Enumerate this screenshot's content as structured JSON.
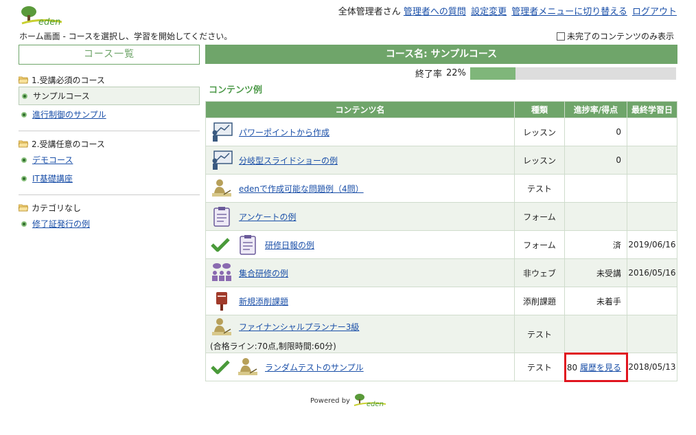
{
  "header": {
    "brand": "eden",
    "user": "全体管理者さん",
    "links": [
      "管理者への質問",
      "設定変更",
      "管理者メニューに切り替える",
      "ログアウト"
    ]
  },
  "intro": "ホーム画面 - コースを選択し、学習を開始してください。",
  "filter_label": "未完了のコンテンツのみ表示",
  "sidebar": {
    "title": "コース一覧",
    "groups": [
      {
        "label": "1.受講必須のコース",
        "items": [
          "サンプルコース",
          "進行制御のサンプル"
        ]
      },
      {
        "label": "2.受講任意のコース",
        "items": [
          "デモコース",
          "IT基礎講座"
        ]
      },
      {
        "label": "カテゴリなし",
        "items": [
          "修了証発行の例"
        ]
      }
    ]
  },
  "main": {
    "course_title": "コース名: サンプルコース",
    "completion_label": "終了率",
    "completion_value": "22%",
    "completion_fraction": 0.22,
    "section_title": "コンテンツ例",
    "columns": [
      "コンテンツ名",
      "種類",
      "進捗率/得点",
      "最終学習日"
    ],
    "rows": [
      {
        "name": "パワーポイントから作成",
        "type": "レッスン",
        "score": "0",
        "date": "",
        "icon": "presentation-icon",
        "done": false
      },
      {
        "name": "分岐型スライドショーの例",
        "type": "レッスン",
        "score": "0",
        "date": "",
        "icon": "presentation-icon",
        "done": false
      },
      {
        "name": "edenで作成可能な問題例（4問）",
        "type": "テスト",
        "score": "",
        "date": "",
        "icon": "test-icon",
        "done": false
      },
      {
        "name": "アンケートの例",
        "type": "フォーム",
        "score": "",
        "date": "",
        "icon": "clipboard-icon",
        "done": false
      },
      {
        "name": "研修日報の例",
        "type": "フォーム",
        "score": "済",
        "date": "2019/06/16",
        "icon": "clipboard-icon",
        "done": true
      },
      {
        "name": "集合研修の例",
        "type": "非ウェブ",
        "score": "未受講",
        "date": "2016/05/16",
        "icon": "group-icon",
        "done": false
      },
      {
        "name": "新規添削課題",
        "type": "添削課題",
        "score": "未着手",
        "date": "",
        "icon": "postbox-icon",
        "done": false
      },
      {
        "name": "ファイナンシャルプランナー3級",
        "note": "(合格ライン:70点,制限時間:60分)",
        "type": "テスト",
        "score": "",
        "date": "",
        "icon": "test-icon",
        "done": false
      },
      {
        "name": "ランダムテストのサンプル",
        "type": "テスト",
        "score": "80",
        "history": "履歴を見る",
        "date": "2018/05/13",
        "icon": "test-icon",
        "done": true
      }
    ]
  },
  "footer": {
    "powered_by": "Powered by",
    "brand": "eden"
  },
  "colors": {
    "accent": "#6fa56a",
    "row_alt": "#eef3ec",
    "link": "#1a4fa8",
    "highlight": "#e0141e"
  }
}
